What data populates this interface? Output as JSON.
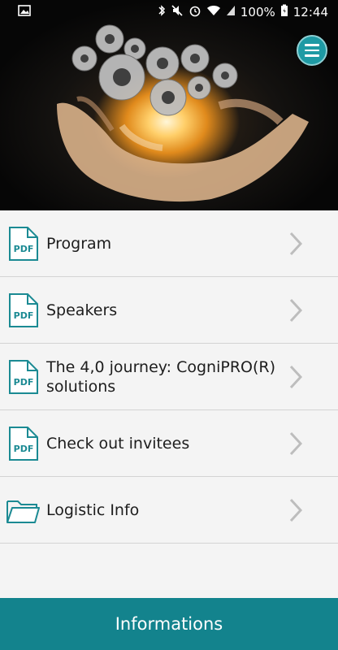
{
  "statusbar": {
    "battery": "100%",
    "time": "12:44"
  },
  "items": [
    {
      "label": "Program",
      "icon": "pdf-icon"
    },
    {
      "label": "Speakers",
      "icon": "pdf-icon"
    },
    {
      "label": "The 4,0 journey: CogniPRO(R) solutions",
      "icon": "pdf-icon"
    },
    {
      "label": "Check out invitees",
      "icon": "pdf-icon"
    },
    {
      "label": "Logistic Info",
      "icon": "folder-icon"
    }
  ],
  "bottom_bar": {
    "label": "Informations"
  },
  "colors": {
    "accent": "#13838d",
    "menu_button": "#1e9aa4",
    "icon_stroke": "#1b8a93"
  }
}
